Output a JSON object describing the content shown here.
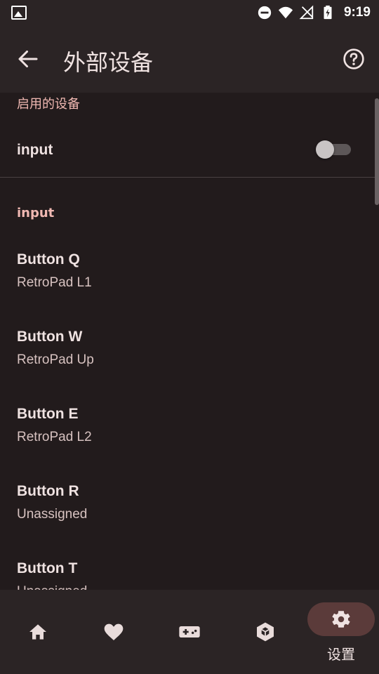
{
  "status_bar": {
    "time": "9:19"
  },
  "app_bar": {
    "title": "外部设备"
  },
  "sections": {
    "enabled_header": "启用的设备",
    "enabled_device": {
      "label": "input",
      "enabled": false
    },
    "input_header": "input"
  },
  "mappings": [
    {
      "key": "Button Q",
      "value": "RetroPad L1"
    },
    {
      "key": "Button W",
      "value": "RetroPad Up"
    },
    {
      "key": "Button E",
      "value": "RetroPad L2"
    },
    {
      "key": "Button R",
      "value": "Unassigned"
    },
    {
      "key": "Button T",
      "value": "Unassigned"
    }
  ],
  "bottom_nav": {
    "items": [
      {
        "icon": "home-icon"
      },
      {
        "icon": "heart-icon"
      },
      {
        "icon": "gamepad-icon"
      },
      {
        "icon": "cube-icon"
      },
      {
        "icon": "gear-icon",
        "label": "设置",
        "active": true
      }
    ]
  },
  "colors": {
    "background": "#221b1c",
    "bar": "#2b2425",
    "accent_text": "#f0b8b2",
    "active_pill": "#5b3b3a"
  }
}
